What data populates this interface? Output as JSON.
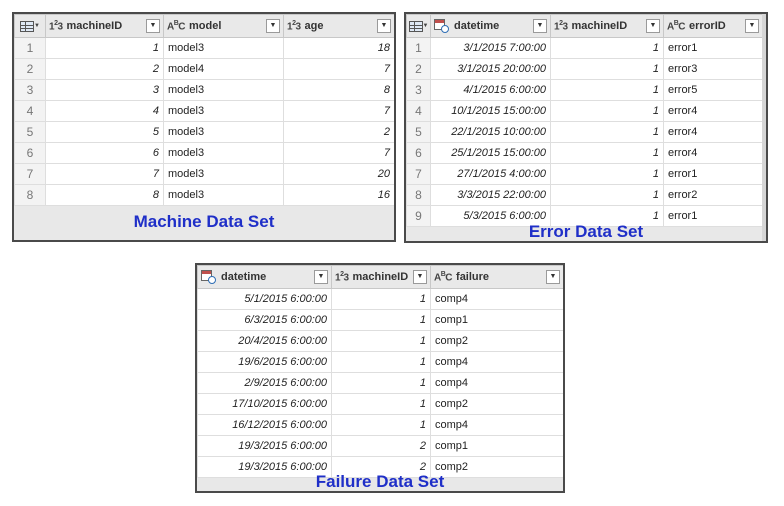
{
  "machine": {
    "caption": "Machine Data Set",
    "columns": [
      {
        "type_icon": "123",
        "label": "machineID"
      },
      {
        "type_icon": "ABC",
        "label": "model"
      },
      {
        "type_icon": "123",
        "label": "age"
      }
    ],
    "rows": [
      {
        "n": "1",
        "machineID": "1",
        "model": "model3",
        "age": "18"
      },
      {
        "n": "2",
        "machineID": "2",
        "model": "model4",
        "age": "7"
      },
      {
        "n": "3",
        "machineID": "3",
        "model": "model3",
        "age": "8"
      },
      {
        "n": "4",
        "machineID": "4",
        "model": "model3",
        "age": "7"
      },
      {
        "n": "5",
        "machineID": "5",
        "model": "model3",
        "age": "2"
      },
      {
        "n": "6",
        "machineID": "6",
        "model": "model3",
        "age": "7"
      },
      {
        "n": "7",
        "machineID": "7",
        "model": "model3",
        "age": "20"
      },
      {
        "n": "8",
        "machineID": "8",
        "model": "model3",
        "age": "16"
      }
    ]
  },
  "errors": {
    "caption": "Error Data Set",
    "columns": [
      {
        "type_icon": "calendar-clock",
        "label": "datetime"
      },
      {
        "type_icon": "123",
        "label": "machineID"
      },
      {
        "type_icon": "ABC",
        "label": "errorID"
      }
    ],
    "rows": [
      {
        "n": "1",
        "datetime": "3/1/2015 7:00:00",
        "machineID": "1",
        "errorID": "error1"
      },
      {
        "n": "2",
        "datetime": "3/1/2015 20:00:00",
        "machineID": "1",
        "errorID": "error3"
      },
      {
        "n": "3",
        "datetime": "4/1/2015 6:00:00",
        "machineID": "1",
        "errorID": "error5"
      },
      {
        "n": "4",
        "datetime": "10/1/2015 15:00:00",
        "machineID": "1",
        "errorID": "error4"
      },
      {
        "n": "5",
        "datetime": "22/1/2015 10:00:00",
        "machineID": "1",
        "errorID": "error4"
      },
      {
        "n": "6",
        "datetime": "25/1/2015 15:00:00",
        "machineID": "1",
        "errorID": "error4"
      },
      {
        "n": "7",
        "datetime": "27/1/2015 4:00:00",
        "machineID": "1",
        "errorID": "error1"
      },
      {
        "n": "8",
        "datetime": "3/3/2015 22:00:00",
        "machineID": "1",
        "errorID": "error2"
      },
      {
        "n": "9",
        "datetime": "5/3/2015 6:00:00",
        "machineID": "1",
        "errorID": "error1"
      }
    ]
  },
  "failures": {
    "caption": "Failure Data Set",
    "columns": [
      {
        "type_icon": "calendar-clock",
        "label": "datetime"
      },
      {
        "type_icon": "123",
        "label": "machineID"
      },
      {
        "type_icon": "ABC",
        "label": "failure"
      }
    ],
    "rows": [
      {
        "datetime": "5/1/2015 6:00:00",
        "machineID": "1",
        "failure": "comp4"
      },
      {
        "datetime": "6/3/2015 6:00:00",
        "machineID": "1",
        "failure": "comp1"
      },
      {
        "datetime": "20/4/2015 6:00:00",
        "machineID": "1",
        "failure": "comp2"
      },
      {
        "datetime": "19/6/2015 6:00:00",
        "machineID": "1",
        "failure": "comp4"
      },
      {
        "datetime": "2/9/2015 6:00:00",
        "machineID": "1",
        "failure": "comp4"
      },
      {
        "datetime": "17/10/2015 6:00:00",
        "machineID": "1",
        "failure": "comp2"
      },
      {
        "datetime": "16/12/2015 6:00:00",
        "machineID": "1",
        "failure": "comp4"
      },
      {
        "datetime": "19/3/2015 6:00:00",
        "machineID": "2",
        "failure": "comp1"
      },
      {
        "datetime": "19/3/2015 6:00:00",
        "machineID": "2",
        "failure": "comp2"
      }
    ]
  },
  "icons": {
    "table_menu": "table-grid-icon",
    "whole_number": "whole-number-type-icon",
    "text": "text-type-icon",
    "datetime": "datetime-type-icon",
    "filter_dropdown": "dropdown-arrow-icon"
  },
  "colors": {
    "caption": "#1f2fc8",
    "border": "#4a4a4a",
    "header_bg": "#e9e9e9"
  }
}
